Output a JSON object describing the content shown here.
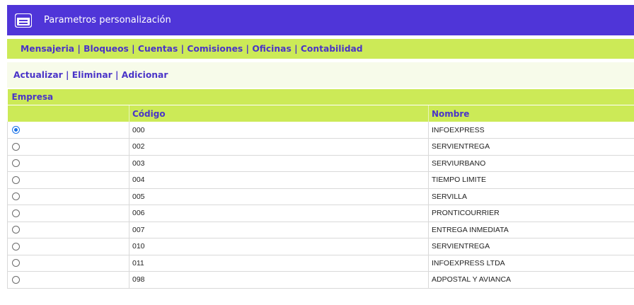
{
  "window": {
    "title": "Parametros personalización",
    "icon": "window-icon"
  },
  "menu": {
    "items": [
      "Mensajeria",
      "Bloqueos",
      "Cuentas",
      "Comisiones",
      "Oficinas",
      "Contabilidad"
    ],
    "separator": "|"
  },
  "actions": {
    "items": [
      "Actualizar",
      "Eliminar",
      "Adicionar"
    ],
    "separator": "|"
  },
  "table": {
    "caption": "Empresa",
    "columns": [
      "",
      "Código",
      "Nombre"
    ],
    "selected_index": 0,
    "rows": [
      {
        "codigo": "000",
        "nombre": "INFOEXPRESS"
      },
      {
        "codigo": "002",
        "nombre": "SERVIENTREGA"
      },
      {
        "codigo": "003",
        "nombre": "SERVIURBANO"
      },
      {
        "codigo": "004",
        "nombre": "TIEMPO LIMITE"
      },
      {
        "codigo": "005",
        "nombre": "SERVILLA"
      },
      {
        "codigo": "006",
        "nombre": "PRONTICOURRIER"
      },
      {
        "codigo": "007",
        "nombre": "ENTREGA INMEDIATA"
      },
      {
        "codigo": "010",
        "nombre": "SERVIENTREGA"
      },
      {
        "codigo": "011",
        "nombre": "INFOEXPRESS LTDA"
      },
      {
        "codigo": "098",
        "nombre": "ADPOSTAL Y AVIANCA"
      }
    ]
  },
  "colors": {
    "titlebar": "#4f35d8",
    "menubar": "#ccea57",
    "link": "#4a34c8",
    "action_bg": "#f7fbea"
  }
}
